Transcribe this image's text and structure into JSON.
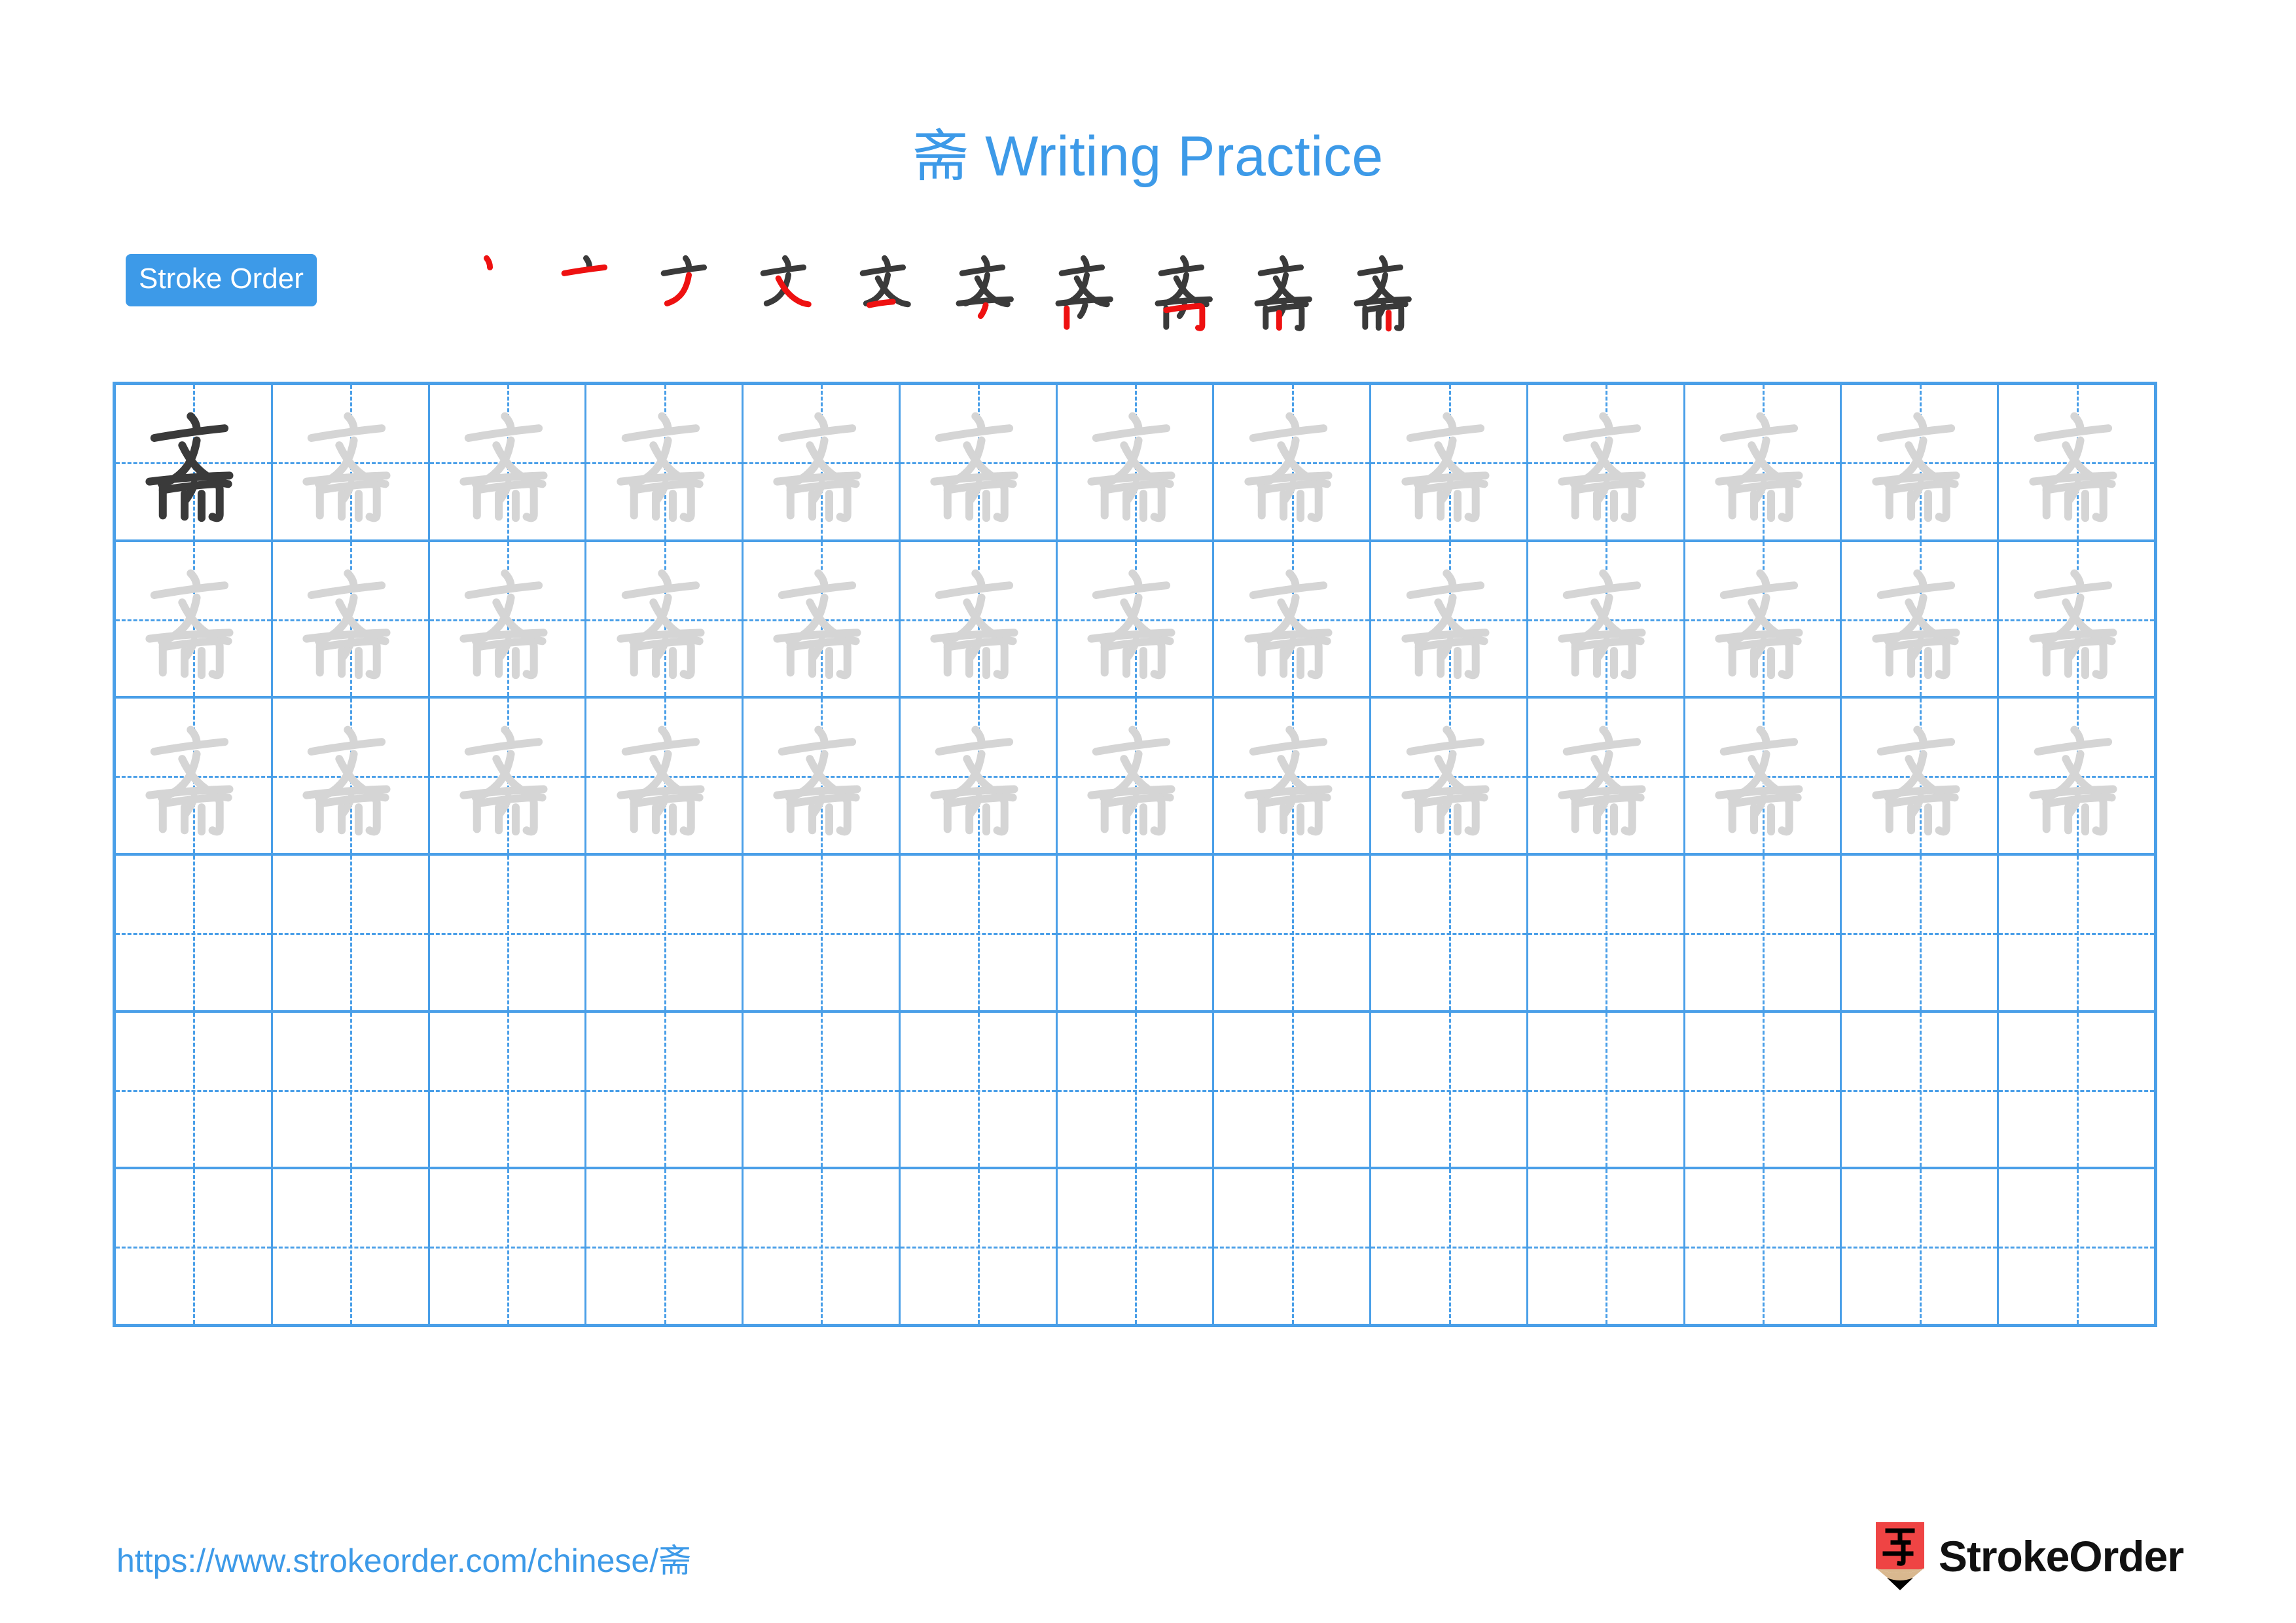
{
  "page": {
    "character": "斋",
    "title": "斋 Writing Practice",
    "background_color": "#ffffff"
  },
  "colors": {
    "accent_blue": "#3d9ae8",
    "grid_blue": "#4a9fe8",
    "example_dark": "#3a3a3a",
    "trace_gray": "#d5d5d5",
    "new_stroke_red": "#ee1111",
    "logo_red": "#ef4444",
    "logo_tan": "#d9b88f",
    "brand_text": "#111111"
  },
  "stroke_order": {
    "badge_label": "Stroke Order",
    "total_strokes": 10,
    "steps": [
      {
        "index": 1,
        "new_stroke_name": "dian"
      },
      {
        "index": 2,
        "new_stroke_name": "heng"
      },
      {
        "index": 3,
        "new_stroke_name": "pie"
      },
      {
        "index": 4,
        "new_stroke_name": "na"
      },
      {
        "index": 5,
        "new_stroke_name": "heng"
      },
      {
        "index": 6,
        "new_stroke_name": "pie"
      },
      {
        "index": 7,
        "new_stroke_name": "shu"
      },
      {
        "index": 8,
        "new_stroke_name": "heng-zhe-gou"
      },
      {
        "index": 9,
        "new_stroke_name": "shu"
      },
      {
        "index": 10,
        "new_stroke_name": "shu"
      }
    ]
  },
  "grid": {
    "columns": 13,
    "rows": 6,
    "filled_rows": 3,
    "empty_rows": 3,
    "example_cell": {
      "row": 1,
      "column": 1,
      "style": "dark"
    },
    "trace_cell_style": "light-gray",
    "guide_lines": "dashed-cross"
  },
  "footer": {
    "url": "https://www.strokeorder.com/chinese/斋",
    "brand_name": "StrokeOrder",
    "logo_character": "字"
  }
}
